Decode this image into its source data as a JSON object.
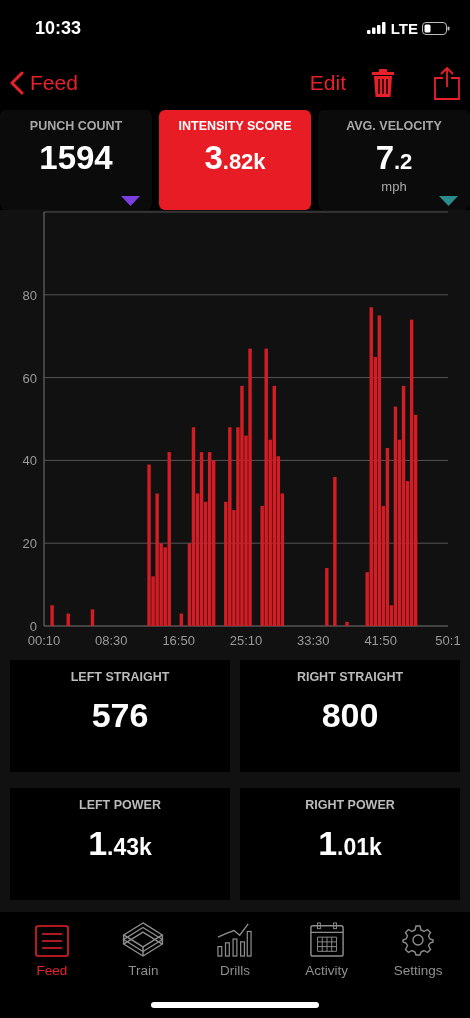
{
  "status_bar": {
    "time": "10:33",
    "network": "LTE"
  },
  "nav": {
    "back_label": "Feed",
    "edit_label": "Edit"
  },
  "stats": [
    {
      "label": "PUNCH COUNT",
      "value": "1594",
      "selected": false,
      "color": "#7b3fe0"
    },
    {
      "label": "INTENSITY SCORE",
      "value": "3",
      "fraction": ".82k",
      "selected": true
    },
    {
      "label": "AVG. VELOCITY",
      "value": "7",
      "fraction": ".2",
      "unit": "mph",
      "selected": false,
      "color": "#2a8c8c"
    }
  ],
  "chart_data": {
    "type": "bar",
    "grid": true,
    "x": [
      10,
      40,
      70,
      100,
      130,
      160,
      190,
      220,
      250,
      280,
      310,
      340,
      370,
      400,
      430,
      460,
      490,
      520,
      550,
      580,
      610,
      640,
      670,
      700,
      730,
      760,
      790,
      820,
      850,
      880,
      910,
      940,
      970,
      1000,
      1030,
      1060,
      1090,
      1120,
      1150,
      1180,
      1210,
      1240,
      1270,
      1300,
      1330,
      1360,
      1390,
      1420,
      1450,
      1480,
      1510,
      1540,
      1570,
      1600,
      1630,
      1660,
      1690,
      1720,
      1750,
      1780,
      1810,
      1840,
      1870,
      1900,
      1930,
      1960,
      1990,
      2020,
      2050,
      2080,
      2110,
      2140,
      2170,
      2200,
      2230,
      2260,
      2290,
      2320,
      2350,
      2380,
      2410,
      2440,
      2470,
      2500,
      2530,
      2560,
      2590,
      2620,
      2650,
      2680,
      2710,
      2740,
      2770,
      2800,
      2830,
      2860,
      2890,
      2920,
      2950,
      2980,
      3010
    ],
    "xlim": [
      10,
      3010
    ],
    "ylim": [
      0,
      100
    ],
    "yticks": [
      0,
      20,
      40,
      60,
      80
    ],
    "xticks": [
      {
        "value": 10,
        "label": "00:10"
      },
      {
        "value": 510,
        "label": "08:30"
      },
      {
        "value": 1010,
        "label": "16:50"
      },
      {
        "value": 1510,
        "label": "25:10"
      },
      {
        "value": 2010,
        "label": "33:30"
      },
      {
        "value": 2510,
        "label": "41:50"
      },
      {
        "value": 3010,
        "label": "50:1"
      }
    ],
    "series": [
      {
        "color": "#d21d24",
        "values": [
          0,
          0,
          5,
          0,
          0,
          0,
          3,
          0,
          0,
          0,
          0,
          0,
          4,
          0,
          0,
          0,
          0,
          0,
          0,
          0,
          0,
          0,
          0,
          0,
          0,
          0,
          39,
          12,
          32,
          20,
          19,
          42,
          0,
          0,
          3,
          0,
          20,
          48,
          32,
          42,
          30,
          42,
          40,
          0,
          0,
          30,
          48,
          28,
          48,
          58,
          46,
          67,
          0,
          0,
          29,
          67,
          45,
          58,
          41,
          32,
          0,
          0,
          0,
          0,
          0,
          0,
          0,
          0,
          0,
          0,
          14,
          0,
          36,
          0,
          0,
          1,
          0,
          0,
          0,
          0,
          13,
          77,
          65,
          75,
          29,
          43,
          5,
          53,
          45,
          58,
          35,
          74,
          51,
          0,
          0,
          0,
          0,
          0,
          0,
          0,
          0
        ]
      }
    ]
  },
  "metrics": [
    {
      "label": "LEFT STRAIGHT",
      "value": "576"
    },
    {
      "label": "RIGHT STRAIGHT",
      "value": "800"
    },
    {
      "label": "LEFT POWER",
      "value": "1",
      "fraction": ".43k"
    },
    {
      "label": "RIGHT POWER",
      "value": "1",
      "fraction": ".01k"
    }
  ],
  "tabs": [
    {
      "label": "Feed",
      "kind": "feed",
      "selected": true
    },
    {
      "label": "Train",
      "kind": "ring",
      "selected": false
    },
    {
      "label": "Drills",
      "kind": "drills",
      "selected": false
    },
    {
      "label": "Activity",
      "kind": "calendar",
      "selected": false
    },
    {
      "label": "Settings",
      "kind": "gear",
      "selected": false
    }
  ]
}
